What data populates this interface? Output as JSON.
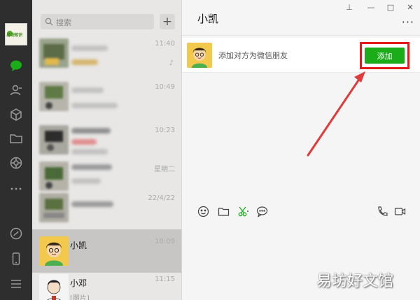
{
  "app": {
    "logo_text": "易坊知识"
  },
  "search": {
    "placeholder": "搜索"
  },
  "chats": [
    {
      "name": "",
      "time": "11:40",
      "blurred": true
    },
    {
      "name": "",
      "time": "10:49",
      "blurred": true
    },
    {
      "name": "",
      "time": "10:23",
      "blurred": true
    },
    {
      "name": "",
      "time": "星期二",
      "blurred": true
    },
    {
      "name": "",
      "time": "22/4/22",
      "blurred": true
    },
    {
      "name": "小凯",
      "time": "10:09",
      "sub": "",
      "active": true
    },
    {
      "name": "小邓",
      "time": "11:15",
      "sub": "[图片]"
    }
  ],
  "conversation": {
    "title": "小凯",
    "add_prompt": "添加对方为微信朋友",
    "add_button": "添加"
  },
  "colors": {
    "accent_green": "#1aad19",
    "highlight_red": "#e11a1a",
    "rail": "#2e2e2e"
  },
  "watermark": "易坊好文馆"
}
